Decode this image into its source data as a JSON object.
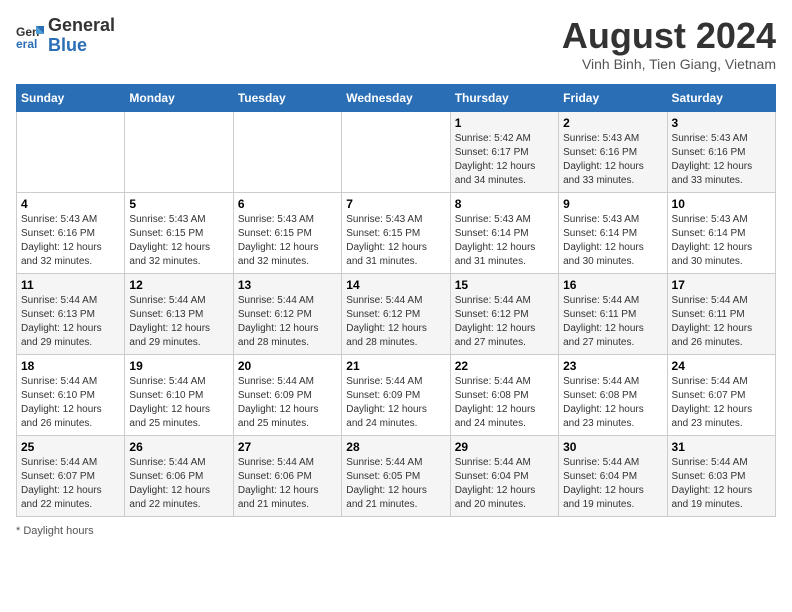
{
  "header": {
    "logo_general": "General",
    "logo_blue": "Blue",
    "month_year": "August 2024",
    "location": "Vinh Binh, Tien Giang, Vietnam"
  },
  "weekdays": [
    "Sunday",
    "Monday",
    "Tuesday",
    "Wednesday",
    "Thursday",
    "Friday",
    "Saturday"
  ],
  "footer": {
    "note": "Daylight hours"
  },
  "weeks": [
    [
      {
        "day": "",
        "detail": ""
      },
      {
        "day": "",
        "detail": ""
      },
      {
        "day": "",
        "detail": ""
      },
      {
        "day": "",
        "detail": ""
      },
      {
        "day": "1",
        "detail": "Sunrise: 5:42 AM\nSunset: 6:17 PM\nDaylight: 12 hours\nand 34 minutes."
      },
      {
        "day": "2",
        "detail": "Sunrise: 5:43 AM\nSunset: 6:16 PM\nDaylight: 12 hours\nand 33 minutes."
      },
      {
        "day": "3",
        "detail": "Sunrise: 5:43 AM\nSunset: 6:16 PM\nDaylight: 12 hours\nand 33 minutes."
      }
    ],
    [
      {
        "day": "4",
        "detail": "Sunrise: 5:43 AM\nSunset: 6:16 PM\nDaylight: 12 hours\nand 32 minutes."
      },
      {
        "day": "5",
        "detail": "Sunrise: 5:43 AM\nSunset: 6:15 PM\nDaylight: 12 hours\nand 32 minutes."
      },
      {
        "day": "6",
        "detail": "Sunrise: 5:43 AM\nSunset: 6:15 PM\nDaylight: 12 hours\nand 32 minutes."
      },
      {
        "day": "7",
        "detail": "Sunrise: 5:43 AM\nSunset: 6:15 PM\nDaylight: 12 hours\nand 31 minutes."
      },
      {
        "day": "8",
        "detail": "Sunrise: 5:43 AM\nSunset: 6:14 PM\nDaylight: 12 hours\nand 31 minutes."
      },
      {
        "day": "9",
        "detail": "Sunrise: 5:43 AM\nSunset: 6:14 PM\nDaylight: 12 hours\nand 30 minutes."
      },
      {
        "day": "10",
        "detail": "Sunrise: 5:43 AM\nSunset: 6:14 PM\nDaylight: 12 hours\nand 30 minutes."
      }
    ],
    [
      {
        "day": "11",
        "detail": "Sunrise: 5:44 AM\nSunset: 6:13 PM\nDaylight: 12 hours\nand 29 minutes."
      },
      {
        "day": "12",
        "detail": "Sunrise: 5:44 AM\nSunset: 6:13 PM\nDaylight: 12 hours\nand 29 minutes."
      },
      {
        "day": "13",
        "detail": "Sunrise: 5:44 AM\nSunset: 6:12 PM\nDaylight: 12 hours\nand 28 minutes."
      },
      {
        "day": "14",
        "detail": "Sunrise: 5:44 AM\nSunset: 6:12 PM\nDaylight: 12 hours\nand 28 minutes."
      },
      {
        "day": "15",
        "detail": "Sunrise: 5:44 AM\nSunset: 6:12 PM\nDaylight: 12 hours\nand 27 minutes."
      },
      {
        "day": "16",
        "detail": "Sunrise: 5:44 AM\nSunset: 6:11 PM\nDaylight: 12 hours\nand 27 minutes."
      },
      {
        "day": "17",
        "detail": "Sunrise: 5:44 AM\nSunset: 6:11 PM\nDaylight: 12 hours\nand 26 minutes."
      }
    ],
    [
      {
        "day": "18",
        "detail": "Sunrise: 5:44 AM\nSunset: 6:10 PM\nDaylight: 12 hours\nand 26 minutes."
      },
      {
        "day": "19",
        "detail": "Sunrise: 5:44 AM\nSunset: 6:10 PM\nDaylight: 12 hours\nand 25 minutes."
      },
      {
        "day": "20",
        "detail": "Sunrise: 5:44 AM\nSunset: 6:09 PM\nDaylight: 12 hours\nand 25 minutes."
      },
      {
        "day": "21",
        "detail": "Sunrise: 5:44 AM\nSunset: 6:09 PM\nDaylight: 12 hours\nand 24 minutes."
      },
      {
        "day": "22",
        "detail": "Sunrise: 5:44 AM\nSunset: 6:08 PM\nDaylight: 12 hours\nand 24 minutes."
      },
      {
        "day": "23",
        "detail": "Sunrise: 5:44 AM\nSunset: 6:08 PM\nDaylight: 12 hours\nand 23 minutes."
      },
      {
        "day": "24",
        "detail": "Sunrise: 5:44 AM\nSunset: 6:07 PM\nDaylight: 12 hours\nand 23 minutes."
      }
    ],
    [
      {
        "day": "25",
        "detail": "Sunrise: 5:44 AM\nSunset: 6:07 PM\nDaylight: 12 hours\nand 22 minutes."
      },
      {
        "day": "26",
        "detail": "Sunrise: 5:44 AM\nSunset: 6:06 PM\nDaylight: 12 hours\nand 22 minutes."
      },
      {
        "day": "27",
        "detail": "Sunrise: 5:44 AM\nSunset: 6:06 PM\nDaylight: 12 hours\nand 21 minutes."
      },
      {
        "day": "28",
        "detail": "Sunrise: 5:44 AM\nSunset: 6:05 PM\nDaylight: 12 hours\nand 21 minutes."
      },
      {
        "day": "29",
        "detail": "Sunrise: 5:44 AM\nSunset: 6:04 PM\nDaylight: 12 hours\nand 20 minutes."
      },
      {
        "day": "30",
        "detail": "Sunrise: 5:44 AM\nSunset: 6:04 PM\nDaylight: 12 hours\nand 19 minutes."
      },
      {
        "day": "31",
        "detail": "Sunrise: 5:44 AM\nSunset: 6:03 PM\nDaylight: 12 hours\nand 19 minutes."
      }
    ]
  ]
}
